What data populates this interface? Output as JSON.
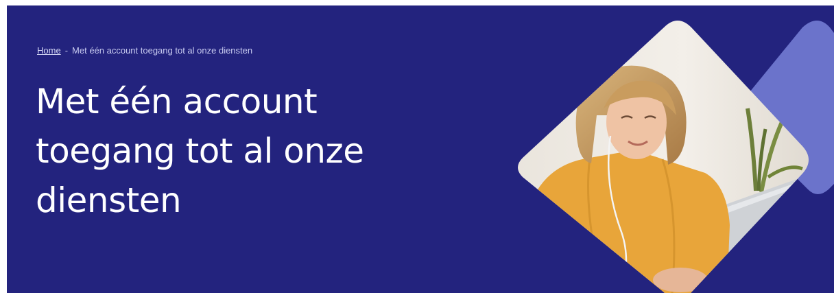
{
  "hero": {
    "breadcrumb": {
      "home_label": "Home",
      "separator": "-",
      "current_label": "Met één account toegang tot al onze diensten"
    },
    "title": "Met één account toegang tot al onze diensten"
  },
  "colors": {
    "hero_background": "#23237e",
    "accent_diamond": "#6b73cb",
    "text": "#ffffff",
    "breadcrumb_text": "#c8cbf0",
    "photo_sweater": "#e8a53a"
  },
  "image": {
    "subject": "woman-with-earphones-at-laptop"
  }
}
